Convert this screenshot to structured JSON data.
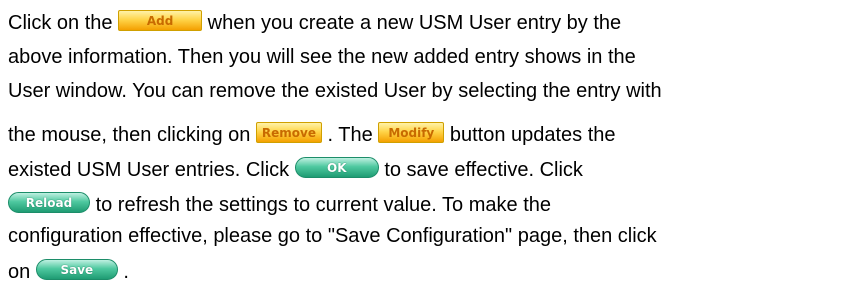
{
  "paragraph": {
    "line1": {
      "before": "Click on the",
      "after": "when you create a new USM User entry by the"
    },
    "line2": "above information. Then you will see the new added entry shows in the",
    "line3": "User window. You can remove the existed User by selecting the entry with",
    "line4": {
      "before": "the mouse, then clicking on",
      "middle": ". The",
      "after": "button updates the"
    },
    "line5": {
      "before": "existed USM User entries. Click",
      "after": "to save effective. Click"
    },
    "line6": {
      "after": "to refresh the settings to current value. To make the"
    },
    "line7": "configuration effective, please go to \"Save Configuration\" page, then click",
    "line8": {
      "before": "on",
      "after": "."
    }
  },
  "buttons": {
    "add": "Add",
    "remove": "Remove",
    "modify": "Modify",
    "ok": "OK",
    "reload": "Reload",
    "save": "Save"
  },
  "colors": {
    "orange_button_text": "#c86a00",
    "green_button_text": "#ffffff"
  },
  "icons": {
    "add": "orange-rectangular-button",
    "remove": "orange-rectangular-button",
    "modify": "orange-rectangular-button",
    "ok": "green-rounded-button",
    "reload": "green-rounded-button",
    "save": "green-rounded-button"
  }
}
